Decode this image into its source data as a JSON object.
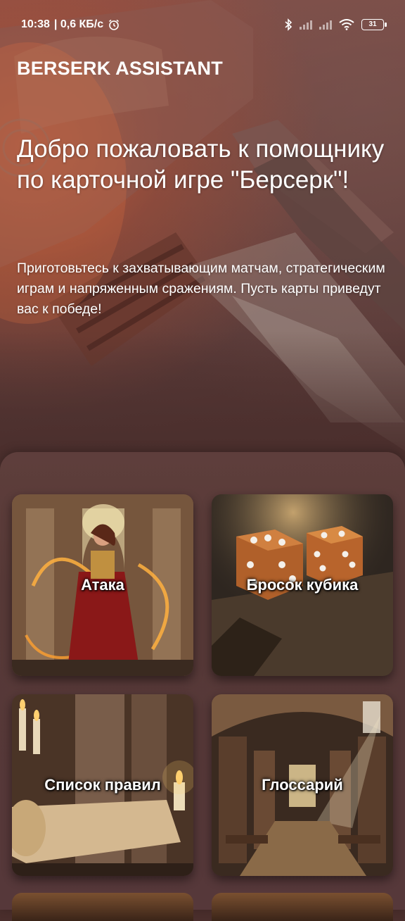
{
  "status_bar": {
    "time": "10:38",
    "network_speed": "| 0,6 КБ/с",
    "battery": "31",
    "icons": [
      "alarm-icon",
      "bluetooth-icon",
      "signal-icon",
      "signal-icon",
      "wifi-icon",
      "battery-icon"
    ]
  },
  "app": {
    "title": "BERSERK ASSISTANT"
  },
  "welcome": {
    "title": "Добро пожаловать к помощнику по карточной игре \"Берсерк\"!",
    "subtitle": "Приготовьтесь к захватывающим матчам, стратегическим играм и напряженным сражениям. Пусть карты приведут вас к победе!"
  },
  "cards": [
    {
      "label": "Атака"
    },
    {
      "label": "Бросок кубика"
    },
    {
      "label": "Список правил"
    },
    {
      "label": "Глоссарий"
    }
  ],
  "colors": {
    "background": "#4a2e2c",
    "accent_fire": "#f0a040",
    "dice": "#b0602a"
  }
}
